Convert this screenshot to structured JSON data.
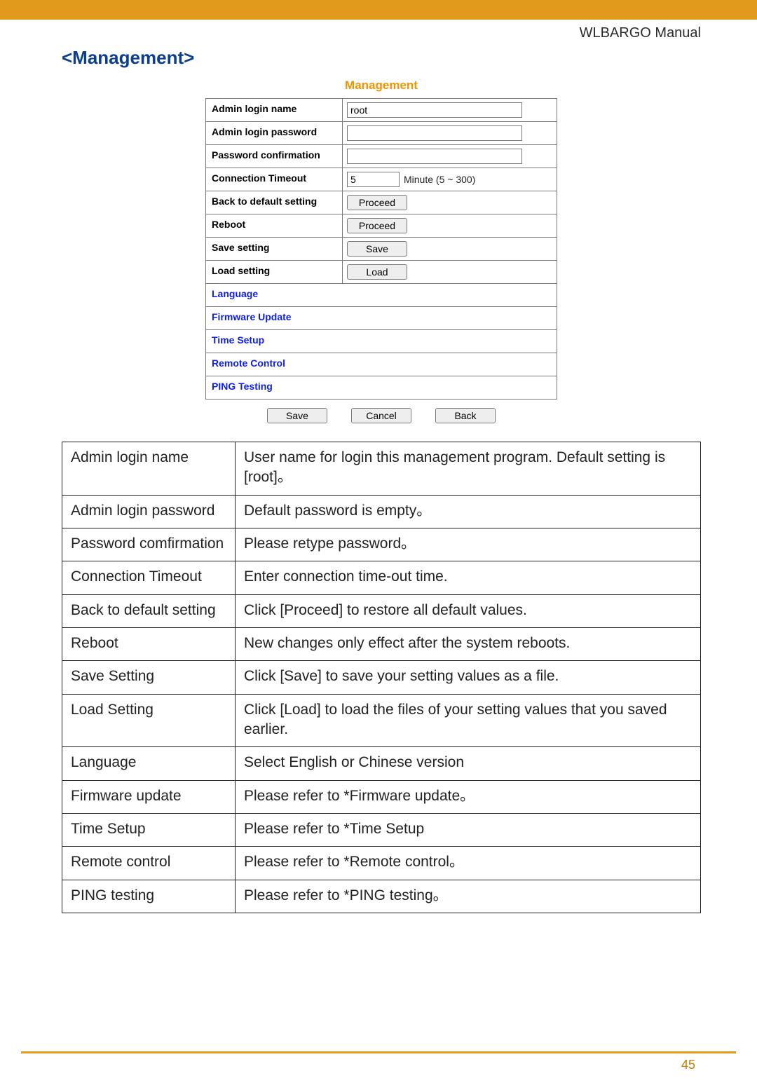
{
  "doc_title": "WLBARGO Manual",
  "section_heading": "<Management>",
  "page_number": "45",
  "screenshot": {
    "title": "Management",
    "rows": [
      {
        "label": "Admin login name"
      },
      {
        "label": "Admin login password"
      },
      {
        "label": "Password confirmation"
      },
      {
        "label": "Connection Timeout"
      },
      {
        "label": "Back to default setting"
      },
      {
        "label": "Reboot"
      },
      {
        "label": "Save setting"
      },
      {
        "label": "Load setting"
      }
    ],
    "admin_login_value": "root",
    "timeout_value": "5",
    "timeout_hint": "Minute (5 ~ 300)",
    "btn_proceed": "Proceed",
    "btn_save_setting": "Save",
    "btn_load_setting": "Load",
    "links": [
      "Language",
      "Firmware Update",
      "Time Setup",
      "Remote Control",
      "PING Testing"
    ],
    "bottom_buttons": {
      "save": "Save",
      "cancel": "Cancel",
      "back": "Back"
    }
  },
  "desc": [
    {
      "term": "Admin login name",
      "text": "User name for login this management program. Default setting is [root]。"
    },
    {
      "term": "Admin login password",
      "text": "Default password is empty。"
    },
    {
      "term": "Password comfirmation",
      "text": "Please retype password。"
    },
    {
      "term": "Connection Timeout",
      "text": "Enter connection time-out time."
    },
    {
      "term": "Back to default setting",
      "text": "Click [Proceed] to restore all default values."
    },
    {
      "term": "Reboot",
      "text": "New changes only effect after the system reboots."
    },
    {
      "term": "Save Setting",
      "text": "Click [Save] to save your setting values as a file."
    },
    {
      "term": "Load Setting",
      "text": "Click [Load] to load the files of your setting values that you saved earlier."
    },
    {
      "term": "Language",
      "text": "Select English or Chinese version"
    },
    {
      "term": "Firmware update",
      "text": "Please refer to *Firmware update。"
    },
    {
      "term": "Time Setup",
      "text": "Please refer to *Time Setup"
    },
    {
      "term": "Remote control",
      "text": "Please refer to *Remote control。"
    },
    {
      "term": "PING testing",
      "text": "Please refer to *PING testing。"
    }
  ]
}
